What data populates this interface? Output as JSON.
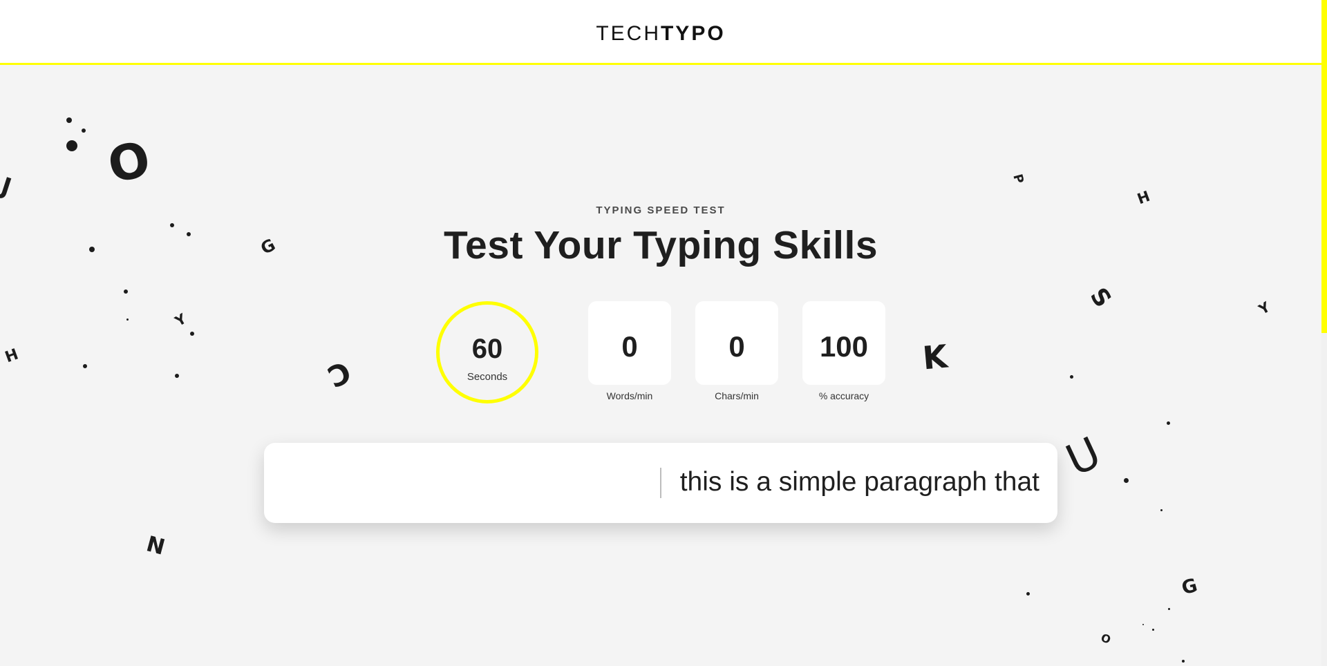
{
  "brand": {
    "tech": "TECH",
    "typo": "TYPO"
  },
  "hero": {
    "eyebrow": "TYPING SPEED TEST",
    "title": "Test Your Typing Skills"
  },
  "stats": {
    "timer": {
      "value": "60",
      "label": "Seconds"
    },
    "words_per_min": {
      "value": "0",
      "label": "Words/min"
    },
    "chars_per_min": {
      "value": "0",
      "label": "Chars/min"
    },
    "accuracy": {
      "value": "100",
      "label": "% accuracy"
    }
  },
  "typing_area": {
    "text": "this is a simple paragraph that"
  },
  "decorations": {
    "letters": {
      "j": "J",
      "o": "O",
      "g1": "G",
      "y1": "Y",
      "h1": "H",
      "c": "C",
      "n": "N",
      "p": "P",
      "h2": "H",
      "s": "S",
      "y2": "Y",
      "k": "K",
      "u": "U",
      "g2": "G",
      "o2": "O"
    }
  },
  "colors": {
    "accent": "#ffff00",
    "background": "#f4f4f4",
    "text": "#1f1f1f",
    "card": "#ffffff"
  }
}
